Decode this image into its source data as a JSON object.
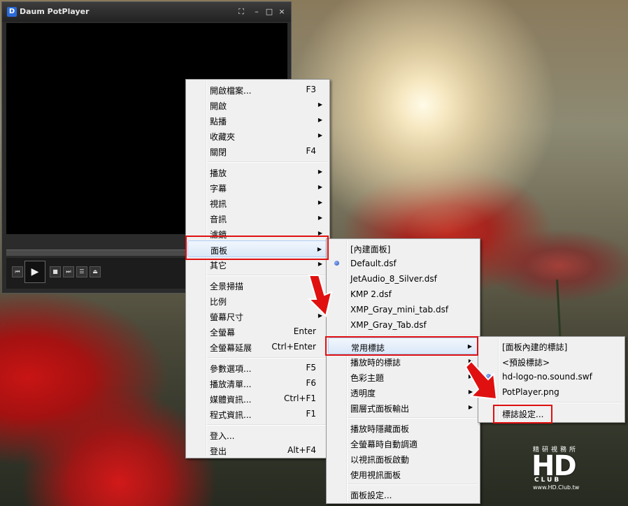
{
  "player": {
    "title": "Daum PotPlayer",
    "logo_letter": "D",
    "window_buttons": [
      "⛶",
      "–",
      "□",
      "×"
    ],
    "control_icons": [
      "⏮",
      "▶",
      "■",
      "⏭",
      "☰",
      "⏏"
    ]
  },
  "main_menu": {
    "items": [
      {
        "label": "開啟檔案...",
        "shortcut": "F3",
        "submenu": false
      },
      {
        "label": "開啟",
        "shortcut": "",
        "submenu": true
      },
      {
        "label": "點播",
        "shortcut": "",
        "submenu": true
      },
      {
        "label": "收藏夾",
        "shortcut": "",
        "submenu": true
      },
      {
        "label": "關閉",
        "shortcut": "F4",
        "submenu": false
      },
      {
        "label": "播放",
        "shortcut": "",
        "submenu": true
      },
      {
        "label": "字幕",
        "shortcut": "",
        "submenu": true
      },
      {
        "label": "視訊",
        "shortcut": "",
        "submenu": true
      },
      {
        "label": "音訊",
        "shortcut": "",
        "submenu": true
      },
      {
        "label": "濾鏡",
        "shortcut": "",
        "submenu": true
      },
      {
        "label": "面板",
        "shortcut": "",
        "submenu": true
      },
      {
        "label": "其它",
        "shortcut": "",
        "submenu": true
      },
      {
        "label": "全景掃描",
        "shortcut": "",
        "submenu": true
      },
      {
        "label": "比例",
        "shortcut": "",
        "submenu": true
      },
      {
        "label": "螢幕尺寸",
        "shortcut": "",
        "submenu": true
      },
      {
        "label": "全螢幕",
        "shortcut": "Enter",
        "submenu": false
      },
      {
        "label": "全螢幕延展",
        "shortcut": "Ctrl+Enter",
        "submenu": false
      },
      {
        "label": "參數選項...",
        "shortcut": "F5",
        "submenu": false
      },
      {
        "label": "播放清單...",
        "shortcut": "F6",
        "submenu": false
      },
      {
        "label": "媒體資訊...",
        "shortcut": "Ctrl+F1",
        "submenu": false
      },
      {
        "label": "程式資訊...",
        "shortcut": "F1",
        "submenu": false
      },
      {
        "label": "登入...",
        "shortcut": "",
        "submenu": false
      },
      {
        "label": "登出",
        "shortcut": "Alt+F4",
        "submenu": false
      }
    ]
  },
  "skin_menu": {
    "items": [
      {
        "label": "[內建面板]",
        "submenu": false,
        "checked": false
      },
      {
        "label": "Default.dsf",
        "submenu": false,
        "checked": true
      },
      {
        "label": "JetAudio_8_Silver.dsf",
        "submenu": false,
        "checked": false
      },
      {
        "label": "KMP 2.dsf",
        "submenu": false,
        "checked": false
      },
      {
        "label": "XMP_Gray_mini_tab.dsf",
        "submenu": false,
        "checked": false
      },
      {
        "label": "XMP_Gray_Tab.dsf",
        "submenu": false,
        "checked": false
      },
      {
        "label": "常用標誌",
        "submenu": true,
        "checked": false
      },
      {
        "label": "播放時的標誌",
        "submenu": true,
        "checked": false
      },
      {
        "label": "色彩主題",
        "submenu": true,
        "checked": false
      },
      {
        "label": "透明度",
        "submenu": true,
        "checked": false
      },
      {
        "label": "圖層式面板輸出",
        "submenu": true,
        "checked": false
      },
      {
        "label": "播放時隱藏面板",
        "submenu": false,
        "checked": false
      },
      {
        "label": "全螢幕時自動調適",
        "submenu": false,
        "checked": false
      },
      {
        "label": "以視訊面板啟動",
        "submenu": false,
        "checked": false
      },
      {
        "label": "使用視訊面板",
        "submenu": false,
        "checked": false
      },
      {
        "label": "面板設定...",
        "submenu": false,
        "checked": false
      }
    ]
  },
  "logo_menu": {
    "items": [
      {
        "label": "[面板內建的標誌]",
        "checked": false
      },
      {
        "label": "<預設標誌>",
        "checked": false
      },
      {
        "label": "hd-logo-no.sound.swf",
        "checked": true
      },
      {
        "label": "PotPlayer.png",
        "checked": false
      },
      {
        "label": "標誌設定...",
        "checked": false
      }
    ]
  },
  "watermark": {
    "chinese": "精研視務所",
    "big": "HD",
    "club": "CLUB",
    "url": "www.HD.Club.tw"
  },
  "colors": {
    "highlight_box": "#e01010",
    "menu_bg": "#f0f0f0"
  }
}
